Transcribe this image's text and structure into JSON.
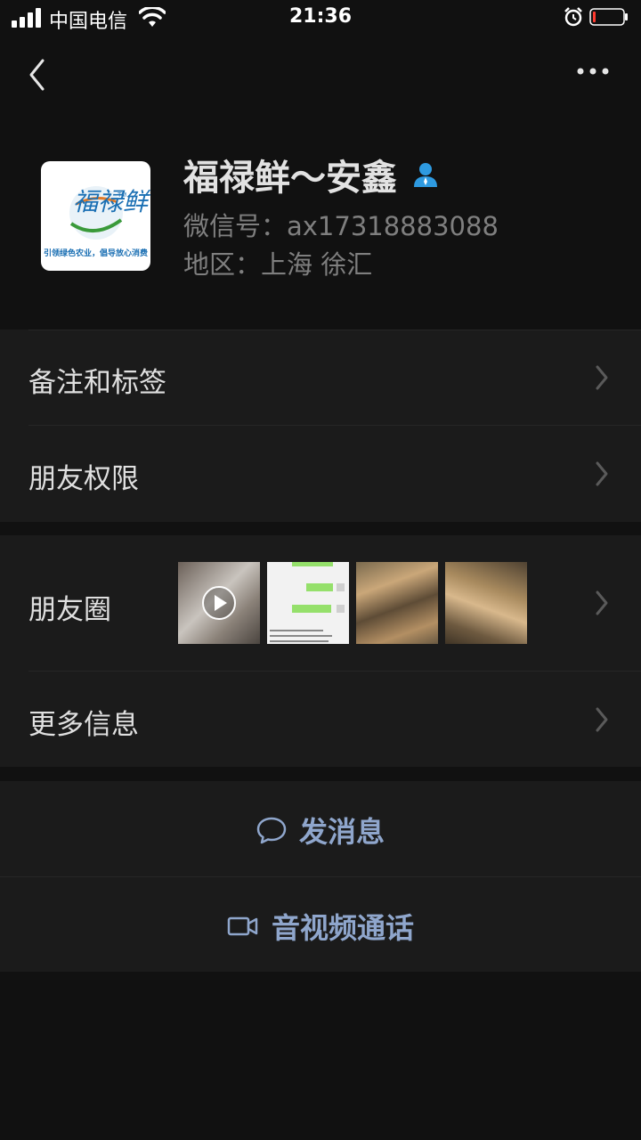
{
  "status_bar": {
    "carrier": "中国电信",
    "time": "21:36"
  },
  "nav": {
    "back_icon": "chevron-left-icon",
    "more_icon": "more-dots-icon"
  },
  "profile": {
    "name": "福禄鲜～安鑫",
    "wechat_id": "微信号：ax17318883088",
    "region": "地区：上海 徐汇",
    "avatar": {
      "logo_text": "福禄鲜",
      "slogan": "引领绿色农业，倡导放心消费"
    }
  },
  "menu": {
    "remarks_tags": "备注和标签",
    "friend_permissions": "朋友权限",
    "moments": "朋友圈",
    "more_info": "更多信息"
  },
  "actions": {
    "send_message": "发消息",
    "video_call": "音视频通话"
  },
  "colors": {
    "background": "#111111",
    "row_bg": "#1b1b1b",
    "action_text": "#8fa6cc",
    "contact_badge": "#2e9ae0"
  }
}
